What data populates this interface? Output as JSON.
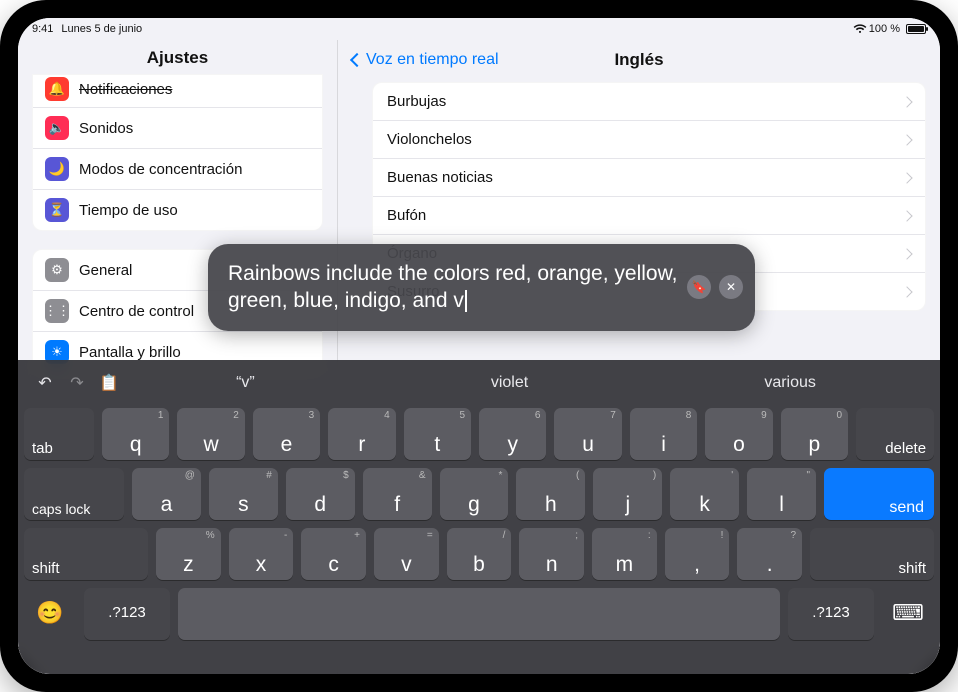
{
  "status": {
    "time": "9:41",
    "date": "Lunes 5 de junio",
    "battery_text": "100 %"
  },
  "sidebar": {
    "title": "Ajustes",
    "group1": [
      {
        "label": "Notificaciones",
        "icon": "bell",
        "color": "ic-red"
      },
      {
        "label": "Sonidos",
        "icon": "speaker",
        "color": "ic-pink"
      },
      {
        "label": "Modos de concentración",
        "icon": "moon",
        "color": "ic-purple"
      },
      {
        "label": "Tiempo de uso",
        "icon": "hourglass",
        "color": "ic-hour"
      }
    ],
    "group2": [
      {
        "label": "General",
        "icon": "gear",
        "color": "ic-gray"
      },
      {
        "label": "Centro de control",
        "icon": "sliders",
        "color": "ic-gray2"
      },
      {
        "label": "Pantalla y brillo",
        "icon": "brightness",
        "color": "ic-blue"
      }
    ]
  },
  "main": {
    "back_label": "Voz en tiempo real",
    "title": "Inglés",
    "items": [
      "Burbujas",
      "Violonchelos",
      "Buenas noticias",
      "Bufón",
      "Órgano",
      "Susurro"
    ]
  },
  "bubble": {
    "text": "Rainbows include the colors red, orange, yellow, green, blue, indigo, and v"
  },
  "keyboard": {
    "candidates": [
      "“v”",
      "violet",
      "various"
    ],
    "row1_subs": [
      "1",
      "2",
      "3",
      "4",
      "5",
      "6",
      "7",
      "8",
      "9",
      "0"
    ],
    "row1": [
      "q",
      "w",
      "e",
      "r",
      "t",
      "y",
      "u",
      "i",
      "o",
      "p"
    ],
    "row2_subs": [
      "@",
      "#",
      "$",
      "&",
      "*",
      "(",
      ")",
      "'",
      "\""
    ],
    "row2": [
      "a",
      "s",
      "d",
      "f",
      "g",
      "h",
      "j",
      "k",
      "l"
    ],
    "row3_subs": [
      "%",
      "-",
      "+",
      "=",
      "/",
      ";",
      ":",
      "!",
      "?"
    ],
    "row3": [
      "z",
      "x",
      "c",
      "v",
      "b",
      "n",
      "m",
      ",",
      "."
    ],
    "tab": "tab",
    "delete": "delete",
    "capslock": "caps lock",
    "send": "send",
    "shift": "shift",
    "numkey": ".?123"
  }
}
